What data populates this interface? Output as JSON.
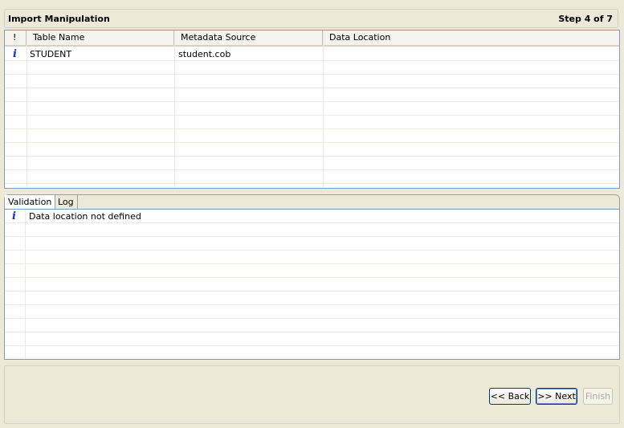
{
  "header": {
    "title": "Import Manipulation",
    "step": "Step 4 of 7"
  },
  "table": {
    "columns": [
      "!",
      "Table Name",
      "Metadata Source",
      "Data Location"
    ],
    "rows": [
      {
        "icon": "info-icon",
        "table_name": "STUDENT",
        "metadata_source": "student.cob",
        "data_location": ""
      }
    ]
  },
  "tabs": [
    {
      "label": "Validation",
      "active": true
    },
    {
      "label": "Log",
      "active": false
    }
  ],
  "validation": {
    "rows": [
      {
        "icon": "info-icon",
        "message": "Data location not defined"
      }
    ]
  },
  "buttons": {
    "back": "<< Back",
    "next": ">> Next",
    "finish": "Finish"
  },
  "colors": {
    "info_icon": "#1c2fbf",
    "accent_border": "#7f9db9"
  }
}
